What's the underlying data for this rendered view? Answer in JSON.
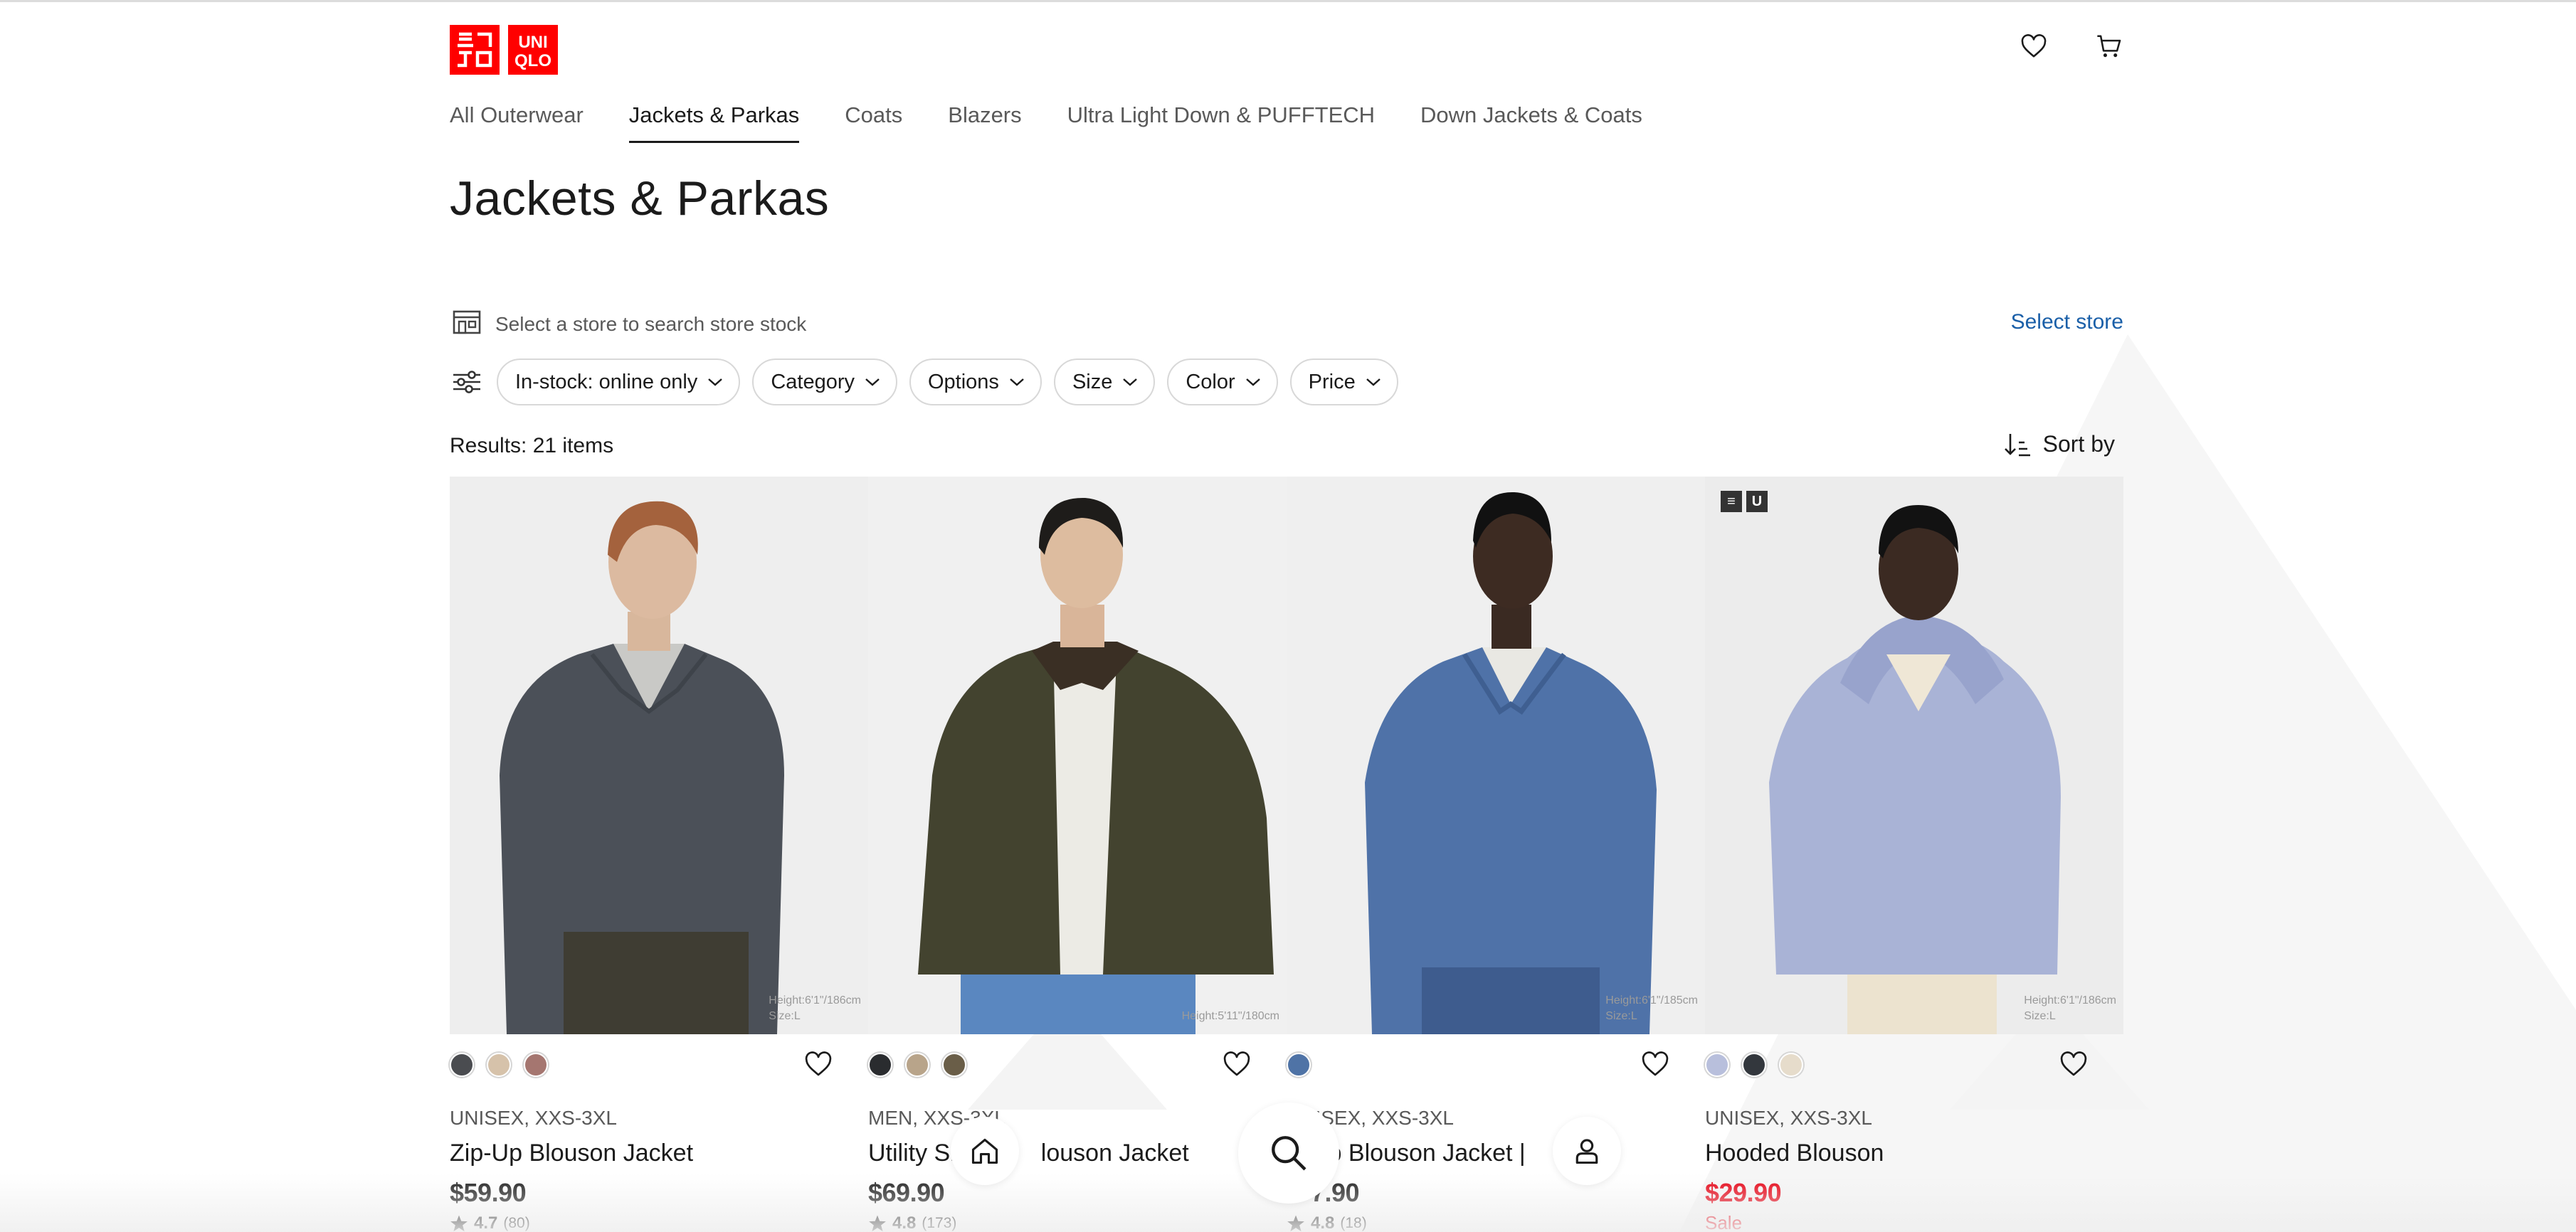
{
  "header": {
    "logo": {
      "line1": "UNI",
      "line2": "QLO"
    },
    "icons": [
      "heart-icon",
      "cart-icon"
    ]
  },
  "nav": {
    "tabs": [
      {
        "label": "All Outerwear",
        "active": false
      },
      {
        "label": "Jackets & Parkas",
        "active": true
      },
      {
        "label": "Coats",
        "active": false
      },
      {
        "label": "Blazers",
        "active": false
      },
      {
        "label": "Ultra Light Down & PUFFTECH",
        "active": false
      },
      {
        "label": "Down Jackets & Coats",
        "active": false
      }
    ]
  },
  "page_title": "Jackets & Parkas",
  "store": {
    "prompt": "Select a store to search store stock",
    "link": "Select store"
  },
  "filters": [
    {
      "label": "In-stock: online only"
    },
    {
      "label": "Category"
    },
    {
      "label": "Options"
    },
    {
      "label": "Size"
    },
    {
      "label": "Color"
    },
    {
      "label": "Price"
    }
  ],
  "results": "Results: 21 items",
  "sort_label": "Sort by",
  "products": [
    {
      "gender_size": "UNISEX, XXS-3XL",
      "name": "Zip-Up Blouson Jacket",
      "price": "$59.90",
      "rating": "4.7",
      "reviews": "(80)",
      "swatches": [
        "#4a4c50",
        "#d6c2aa",
        "#a57670"
      ],
      "model": "Height:6'1\"/186cm",
      "model_size": "Size:L",
      "jacket_color": "#4b5058"
    },
    {
      "gender_size": "MEN, XXS-3XL",
      "name": "Utility Sl",
      "name_rest": "louson Jacket",
      "price": "$69.90",
      "rating": "4.8",
      "reviews": "(173)",
      "swatches": [
        "#2a2c2f",
        "#b8a48a",
        "#6a5e48"
      ],
      "model": "Height:5'11\"/180cm",
      "model_size": "",
      "jacket_color": "#43432f"
    },
    {
      "gender_size": "UNISEX, XXS-3XL",
      "name": "Up Blouson Jacket |",
      "name_rest": "n",
      "price": "7.90",
      "rating": "4.8",
      "reviews": "(18)",
      "swatches": [
        "#4f73a6"
      ],
      "model": "Height:6'1\"/185cm",
      "model_size": "Size:L",
      "jacket_color": "#4f72a8"
    },
    {
      "gender_size": "UNISEX, XXS-3XL",
      "name": "Hooded Blouson",
      "price": "$29.90",
      "sale_label": "Sale",
      "swatches": [
        "#b8bfdc",
        "#33373d",
        "#e6dccb"
      ],
      "model": "Height:6'1\"/186cm",
      "model_size": "Size:L",
      "jacket_color": "#a9b3d6",
      "tag": [
        "≡",
        "U"
      ]
    }
  ],
  "floating_nav": [
    "home-icon",
    "search-icon",
    "account-icon"
  ],
  "colors": {
    "brand_red": "#ff0000",
    "sale_red": "#e60012",
    "link_blue": "#1a5fa8",
    "text": "#1b1b1b",
    "muted": "#595959"
  }
}
